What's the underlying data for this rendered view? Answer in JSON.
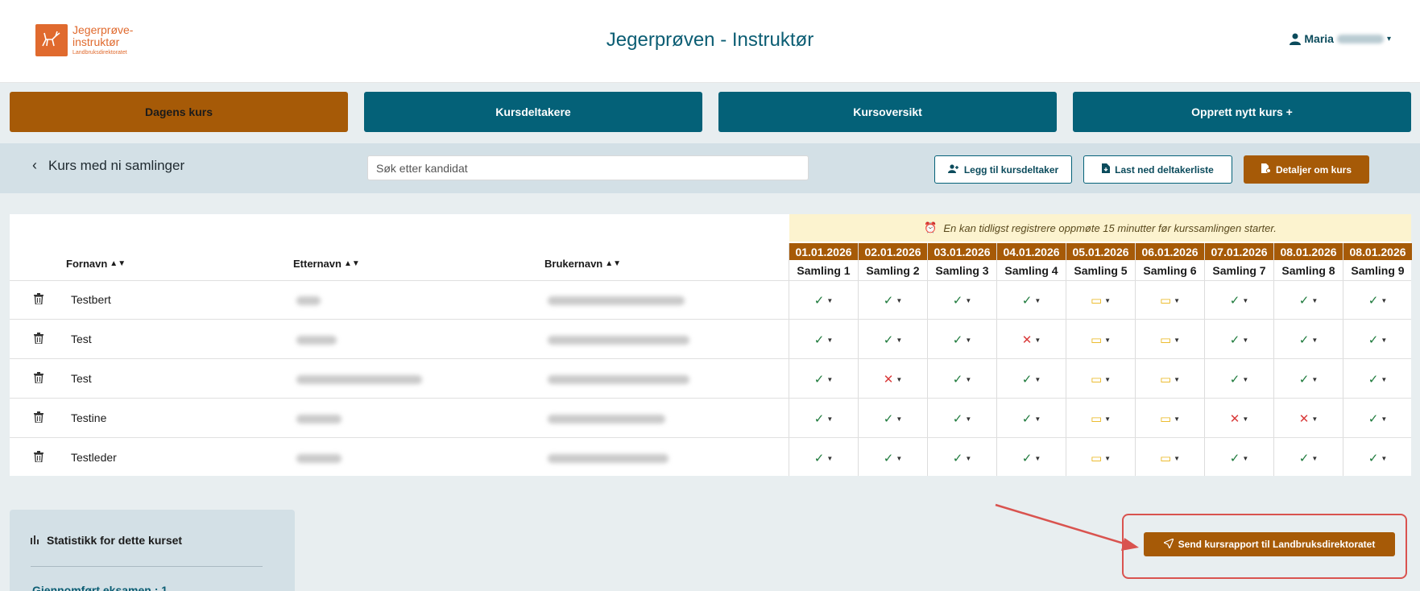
{
  "header": {
    "logo_line1": "Jegerprøve-",
    "logo_line2": "instruktør",
    "logo_sub": "Landbruksdirektoratet",
    "title": "Jegerprøven - Instruktør",
    "user_name": "Maria"
  },
  "nav": {
    "dagens": "Dagens kurs",
    "kursdeltakere": "Kursdeltakere",
    "kursoversikt": "Kursoversikt",
    "opprett": "Opprett nytt kurs +"
  },
  "subbar": {
    "back_label": "Kurs med ni samlinger",
    "search_placeholder": "Søk etter kandidat",
    "add_participant": "Legg til kursdeltaker",
    "download_list": "Last ned deltakerliste",
    "course_details": "Detaljer om kurs"
  },
  "notice": "En kan tidligst registrere oppmøte 15 minutter før kurssamlingen starter.",
  "columns": {
    "fornavn": "Fornavn",
    "etternavn": "Etternavn",
    "brukernavn": "Brukernavn"
  },
  "sessions": [
    {
      "date": "01.01.2026",
      "name": "Samling 1"
    },
    {
      "date": "02.01.2026",
      "name": "Samling 2"
    },
    {
      "date": "03.01.2026",
      "name": "Samling 3"
    },
    {
      "date": "04.01.2026",
      "name": "Samling 4"
    },
    {
      "date": "05.01.2026",
      "name": "Samling 5"
    },
    {
      "date": "06.01.2026",
      "name": "Samling 6"
    },
    {
      "date": "07.01.2026",
      "name": "Samling 7"
    },
    {
      "date": "08.01.2026",
      "name": "Samling 8"
    },
    {
      "date": "08.01.2026",
      "name": "Samling 9"
    }
  ],
  "rows": [
    {
      "fornavn": "Testbert",
      "attendance": [
        "yes",
        "yes",
        "yes",
        "yes",
        "digital",
        "digital",
        "yes",
        "yes",
        "yes"
      ]
    },
    {
      "fornavn": "Test",
      "attendance": [
        "yes",
        "yes",
        "yes",
        "no",
        "digital",
        "digital",
        "yes",
        "yes",
        "yes"
      ]
    },
    {
      "fornavn": "Test",
      "attendance": [
        "yes",
        "no",
        "yes",
        "yes",
        "digital",
        "digital",
        "yes",
        "yes",
        "yes"
      ]
    },
    {
      "fornavn": "Testine",
      "attendance": [
        "yes",
        "yes",
        "yes",
        "yes",
        "digital",
        "digital",
        "no",
        "no",
        "yes"
      ]
    },
    {
      "fornavn": "Testleder",
      "attendance": [
        "yes",
        "yes",
        "yes",
        "yes",
        "digital",
        "digital",
        "yes",
        "yes",
        "yes"
      ]
    }
  ],
  "stats": {
    "title": "Statistikk for dette kurset",
    "item": "Gjennomført eksamen : 1"
  },
  "send_report": "Send kursrapport til Landbruksdirektoratet",
  "colors": {
    "primary": "#046178",
    "accent": "#a65a07",
    "annotation": "#d9534f"
  },
  "icons": {
    "yes": "check-icon",
    "no": "cross-icon",
    "digital": "laptop-icon"
  }
}
